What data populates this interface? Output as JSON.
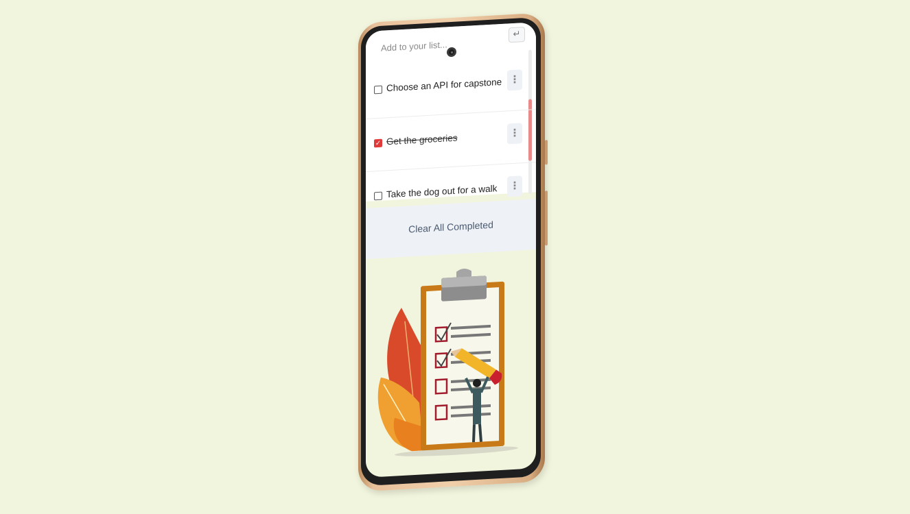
{
  "app": {
    "input": {
      "placeholder": "Add to your list..."
    },
    "enter_icon": "enter-icon",
    "todos": [
      {
        "label": "Choose an API for capstone",
        "completed": false
      },
      {
        "label": "Get the groceries",
        "completed": true
      },
      {
        "label": "Take the dog out for a walk",
        "completed": false
      }
    ],
    "menu_icon": "more-vertical-icon",
    "clear_button": "Clear All Completed"
  },
  "colors": {
    "background": "#f2f5dd",
    "accent": "#e13a3a",
    "phone_frame": "#e8c19b",
    "clipboard": "#c97a18"
  }
}
